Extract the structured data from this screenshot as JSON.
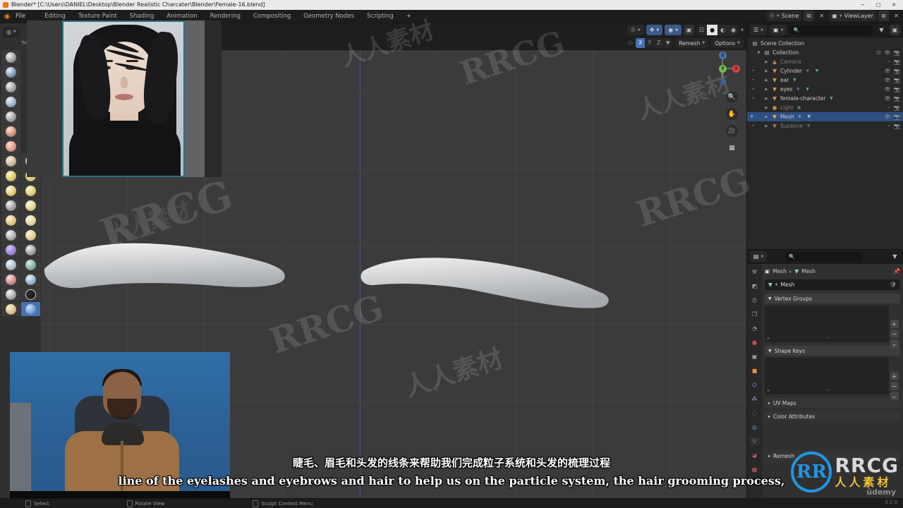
{
  "window": {
    "title": "Blender* [C:\\Users\\DANIEL\\Desktop\\Blender Realistic Charcater\\Blender\\Female-16.blend]",
    "minimize": "─",
    "maximize": "□",
    "close": "✕"
  },
  "topbar": {
    "logo_icon": "blender-logo-icon",
    "menus": [
      "File"
    ],
    "tabs": [
      {
        "label": "Editing",
        "active": false
      },
      {
        "label": "Texture Paint",
        "active": false
      },
      {
        "label": "Shading",
        "active": false
      },
      {
        "label": "Animation",
        "active": false
      },
      {
        "label": "Rendering",
        "active": false
      },
      {
        "label": "Compositing",
        "active": false
      },
      {
        "label": "Geometry Nodes",
        "active": false
      },
      {
        "label": "Scripting",
        "active": false
      },
      {
        "label": "+",
        "active": false
      }
    ],
    "scene": {
      "icon": "scene-icon",
      "value": "Scene",
      "new_icon": "⧉",
      "unlink_icon": "✕"
    },
    "viewlayer": {
      "icon": "viewlayer-icon",
      "value": "ViewLayer",
      "new_icon": "⧉",
      "unlink_icon": "✕"
    }
  },
  "viewport": {
    "mode": {
      "icon": "sculpt-mode-icon",
      "label": ""
    },
    "shading_modes": [
      "wireframe",
      "solid",
      "material-preview",
      "rendered"
    ],
    "active_shading": "solid",
    "symmetry_label": "⚇",
    "symmetry_axes": [
      {
        "label": "X",
        "on": true
      },
      {
        "label": "Y",
        "on": false
      },
      {
        "label": "Z",
        "on": false
      }
    ],
    "remesh_button": "Remesh",
    "options_button": "Options",
    "gizmo_axes": [
      {
        "label": "Z",
        "color": "#4772b3"
      },
      {
        "label": "Y",
        "color": "#6cbf3f"
      },
      {
        "label": "X",
        "color": "#d9443f"
      }
    ],
    "nav_tools": [
      "zoom-icon",
      "hand-pan-icon",
      "camera-view-icon",
      "grid-ortho-icon"
    ],
    "toolshelf_label": "Tri"
  },
  "outliner": {
    "display_mode_icon": "outliner-display-icon",
    "filter_icon": "filter-icon",
    "search_placeholder": "",
    "new_collection_icon": "new-collection-icon",
    "rows": [
      {
        "label": "Scene Collection",
        "depth": 0,
        "icon": "▤",
        "color": "#c8c8c8",
        "selected": false,
        "expander": "",
        "visible": true,
        "dim": false
      },
      {
        "label": "Collection",
        "depth": 1,
        "icon": "▤",
        "color": "#c8c8c8",
        "selected": false,
        "expander": "▼",
        "visible": true,
        "dim": false
      },
      {
        "label": "Camera",
        "depth": 2,
        "icon": "▽",
        "color": "#c08a55",
        "selected": false,
        "expander": "▶",
        "visible": false,
        "dim": true
      },
      {
        "label": "Cylinder",
        "depth": 2,
        "icon": "▽",
        "color": "#d09a52",
        "selected": false,
        "expander": "▶",
        "visible": true,
        "dim": false
      },
      {
        "label": "ear",
        "depth": 2,
        "icon": "▽",
        "color": "#d09a52",
        "selected": false,
        "expander": "▶",
        "visible": true,
        "dim": false
      },
      {
        "label": "eyes",
        "depth": 2,
        "icon": "▽",
        "color": "#d09a52",
        "selected": false,
        "expander": "▶",
        "visible": true,
        "dim": false
      },
      {
        "label": "female-character",
        "depth": 2,
        "icon": "▽",
        "color": "#d09a52",
        "selected": false,
        "expander": "▶",
        "visible": true,
        "dim": false
      },
      {
        "label": "Light",
        "depth": 2,
        "icon": "●",
        "color": "#c08a55",
        "selected": false,
        "expander": "▶",
        "visible": false,
        "dim": true
      },
      {
        "label": "Mesh",
        "depth": 2,
        "icon": "▽",
        "color": "#e0a96b",
        "selected": true,
        "expander": "▶",
        "visible": true,
        "dim": false
      },
      {
        "label": "Suzanne",
        "depth": 2,
        "icon": "▽",
        "color": "#c08a55",
        "selected": false,
        "expander": "▶",
        "visible": false,
        "dim": true
      }
    ]
  },
  "properties": {
    "editor_type_icon": "properties-editor-icon",
    "search_placeholder": "",
    "tabs": [
      {
        "name": "tool",
        "glyph": "⚒",
        "active": false
      },
      {
        "name": "render",
        "glyph": "◩",
        "active": false
      },
      {
        "name": "output",
        "glyph": "⎙",
        "active": false
      },
      {
        "name": "view-layer",
        "glyph": "❐",
        "active": false
      },
      {
        "name": "scene",
        "glyph": "◔",
        "active": false
      },
      {
        "name": "world",
        "glyph": "●",
        "active": false
      },
      {
        "name": "collection",
        "glyph": "▣",
        "active": false
      },
      {
        "name": "object",
        "glyph": "■",
        "active": false
      },
      {
        "name": "modifiers",
        "glyph": "⛭",
        "active": false
      },
      {
        "name": "particles",
        "glyph": "⁂",
        "active": false
      },
      {
        "name": "physics",
        "glyph": "◌",
        "active": false
      },
      {
        "name": "constraints",
        "glyph": "◎",
        "active": false
      },
      {
        "name": "object-data",
        "glyph": "▽",
        "active": true
      },
      {
        "name": "material",
        "glyph": "◕",
        "active": false
      },
      {
        "name": "texture",
        "glyph": "▦",
        "active": false
      }
    ],
    "breadcrumb": [
      {
        "icon": "object-icon",
        "label": "Mesh"
      },
      {
        "icon": "mesh-data-icon",
        "label": "Mesh"
      }
    ],
    "pin_icon": "pin-icon",
    "datablock": {
      "icon": "mesh-data-icon",
      "value": "Mesh",
      "shield_icon": "fake-user-icon"
    },
    "panels": [
      {
        "label": "Vertex Groups",
        "open": true,
        "has_list": true
      },
      {
        "label": "Shape Keys",
        "open": true,
        "has_list": true
      },
      {
        "label": "UV Maps",
        "open": false,
        "has_list": false
      },
      {
        "label": "Color Attributes",
        "open": false,
        "has_list": false
      },
      {
        "label": "Remesh",
        "open": false,
        "has_list": false
      }
    ],
    "list_buttons": [
      "+",
      "−",
      "⌄"
    ]
  },
  "statusbar": {
    "items": [
      {
        "icon": "mouse-left-icon",
        "label": "Select"
      },
      {
        "icon": "mouse-middle-icon",
        "label": "Rotate View"
      },
      {
        "icon": "mouse-right-icon",
        "label": "Sculpt Context Menu"
      }
    ]
  },
  "subtitles": {
    "chinese": "睫毛、眉毛和头发的线条来帮助我们完成粒子系统和头发的梳理过程",
    "english": "line of the eyelashes and eyebrows and hair to help us on the particle system, the hair grooming process,"
  },
  "branding": {
    "logo_mark": "RR",
    "logo_text": "RRCG",
    "logo_sub": "人人素材",
    "platform": "ûdemy",
    "version": "3.2.0",
    "watermarks": [
      "RRCG",
      "人人素材"
    ]
  },
  "overlays": {
    "reference_window": "reference-portrait-image",
    "webcam_window": "instructor-webcam-video"
  },
  "colors": {
    "accent_blue": "#4772b3",
    "selection_blue": "#2f4f82",
    "axis_x": "#d9443f",
    "axis_y": "#6cbf3f",
    "axis_z": "#4772b3",
    "brand_orange": "#e87d0d",
    "viewport_bg": "#3b3b3b",
    "logo_blue": "#2196e3",
    "logo_yellow": "#efc23a"
  }
}
